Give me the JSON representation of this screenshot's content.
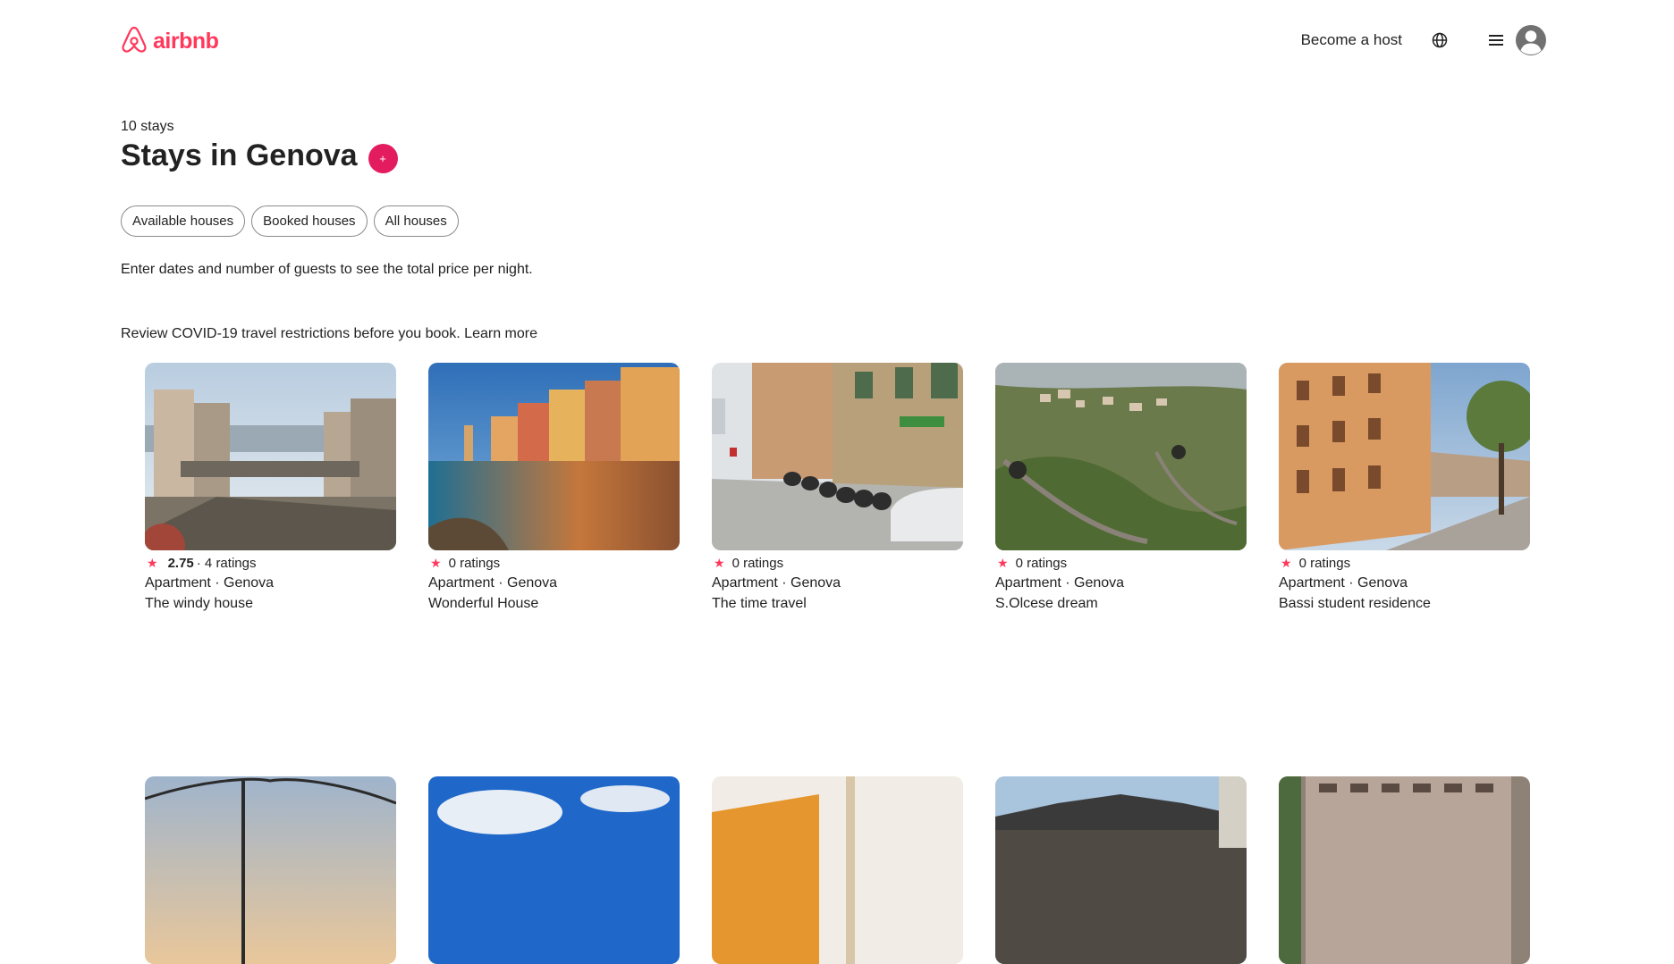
{
  "header": {
    "logo_text": "airbnb",
    "become_host": "Become a host",
    "icons": [
      "airbnb-logo-icon",
      "globe-icon",
      "hamburger-menu-icon",
      "user-avatar-icon"
    ]
  },
  "main": {
    "count": "10 stays",
    "title": "Stays in Genova",
    "add_label": "+",
    "filters": [
      "Available houses",
      "Booked houses",
      "All houses"
    ],
    "hint": "Enter dates and number of guests to see the total price per night.",
    "covid_text": "Review COVID-19 travel restrictions before you book.",
    "covid_link": "Learn more"
  },
  "listings": [
    {
      "score": "2.75",
      "ratings": "· 4 ratings",
      "type": "Apartment · Genova",
      "name": "The windy house"
    },
    {
      "score": "",
      "ratings": "0 ratings",
      "type": "Apartment · Genova",
      "name": "Wonderful House"
    },
    {
      "score": "",
      "ratings": "0 ratings",
      "type": "Apartment · Genova",
      "name": "The time travel"
    },
    {
      "score": "",
      "ratings": "0 ratings",
      "type": "Apartment · Genova",
      "name": "S.Olcese dream"
    },
    {
      "score": "",
      "ratings": "0 ratings",
      "type": "Apartment · Genova",
      "name": "Bassi student residence"
    }
  ],
  "colors": {
    "brand": "#ff385c",
    "add_button": "#e31c5f",
    "text": "#222222"
  }
}
